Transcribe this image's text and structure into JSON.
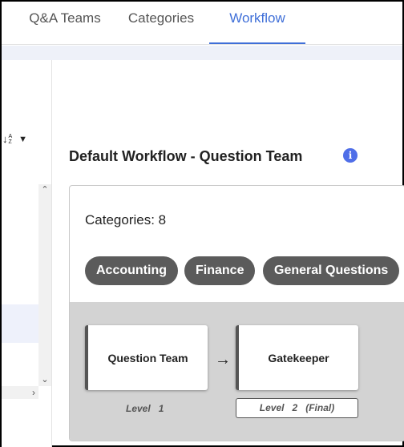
{
  "tabs": [
    {
      "label": "Q&A Teams",
      "active": false
    },
    {
      "label": "Categories",
      "active": false
    },
    {
      "label": "Workflow",
      "active": true
    }
  ],
  "sort": {
    "a_letter": "A",
    "z_letter": "Z",
    "arrow": "↓",
    "caret": "▼"
  },
  "scroll": {
    "up": "^",
    "down": "v",
    "right": ">"
  },
  "workflow": {
    "title": "Default Workflow - Question Team",
    "info_icon": "info-icon",
    "categories_label": "Categories: 8",
    "categories": [
      "Accounting",
      "Finance",
      "General Questions"
    ],
    "steps": [
      {
        "name": "Question Team",
        "level_word": "Level",
        "level_num": "1",
        "level_suffix": ""
      },
      {
        "name": "Gatekeeper",
        "level_word": "Level",
        "level_num": "2",
        "level_suffix": "(Final)"
      }
    ],
    "arrow": "→"
  },
  "colors": {
    "accent": "#3f6fd8",
    "chip_bg": "#5b5b5b",
    "flow_bg": "#d3d3d3",
    "info_bg": "#4f6ee8"
  }
}
